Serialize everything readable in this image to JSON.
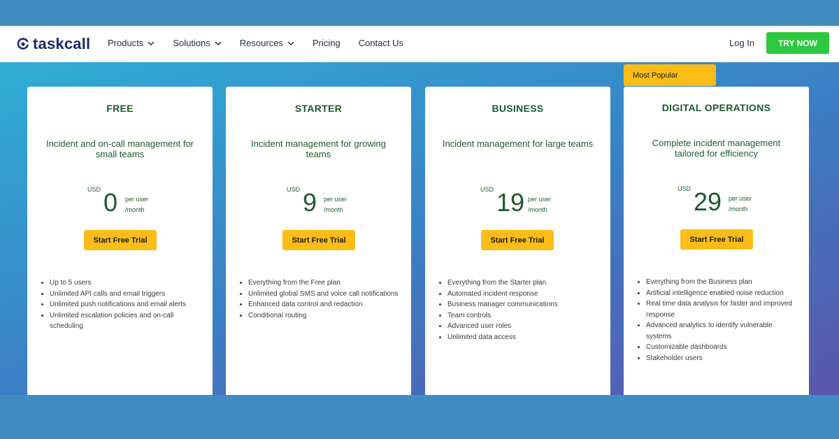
{
  "navbar": {
    "logo_text": "taskcall",
    "items": [
      {
        "label": "Products"
      },
      {
        "label": "Solutions"
      },
      {
        "label": "Resources"
      },
      {
        "label": "Pricing"
      },
      {
        "label": "Contact Us"
      }
    ],
    "login_label": "Log In",
    "try_label": "TRY NOW"
  },
  "badge": {
    "label": "Most Popular"
  },
  "plans": [
    {
      "title": "FREE",
      "subtitle": "Incident and on-call management for small teams",
      "currency": "USD",
      "price": "0",
      "per_line1": "per user",
      "per_line2": "/month",
      "cta": "Start Free Trial",
      "features": [
        "Up to 5 users",
        "Unlimited API calls and email triggers",
        "Unlimited push notifications and email alerts",
        "Unlimited escalation policies and on-call scheduling"
      ]
    },
    {
      "title": "STARTER",
      "subtitle": "Incident management for growing teams",
      "currency": "USD",
      "price": "9",
      "per_line1": "per user",
      "per_line2": "/month",
      "cta": "Start Free Trial",
      "features": [
        "Everything from the Free plan",
        "Unlimited global SMS and voice call notifications",
        "Enhanced data control and redaction",
        "Conditional routing"
      ]
    },
    {
      "title": "BUSINESS",
      "subtitle": "Incident management for large teams",
      "currency": "USD",
      "price": "19",
      "per_line1": "per user",
      "per_line2": "/month",
      "cta": "Start Free Trial",
      "features": [
        "Everything from the Starter plan",
        "Automated incident response",
        "Business manager communications",
        "Team controls",
        "Advanced user roles",
        "Unlimited data access"
      ]
    },
    {
      "title": "DIGITAL OPERATIONS",
      "subtitle": "Complete incident management tailored for efficiency",
      "currency": "USD",
      "price": "29",
      "per_line1": "per user",
      "per_line2": "/month",
      "cta": "Start Free Trial",
      "features": [
        "Everything from the Business plan",
        "Artificial intelligence enabled noise reduction",
        "Real time data analysis for faster and improved response",
        "Advanced analytics to identify vulnerable systems",
        "Customizable dashboards",
        "Stakeholder users"
      ]
    }
  ],
  "colors": {
    "brand": "#1b2a6b",
    "accent_green": "#2ec840",
    "cta_yellow": "#fbbd16",
    "heading_green": "#1d5a2c"
  },
  "icons": {
    "logo": "taskcall-logo-icon",
    "dropdown": "chevron-down-icon",
    "bullet": "bullet-icon"
  }
}
